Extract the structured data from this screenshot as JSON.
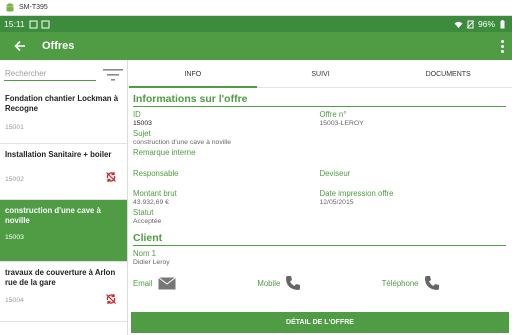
{
  "window": {
    "title": "SM-T395"
  },
  "statusbar": {
    "time": "15:11",
    "battery": "96%"
  },
  "appbar": {
    "title": "Offres"
  },
  "search": {
    "placeholder": "Rechercher"
  },
  "offers": [
    {
      "name": "Fondation chantier Lockman à Recogne",
      "number": "15001",
      "sync_icon": false,
      "selected": false
    },
    {
      "name": "Installation Sanitaire + boiler",
      "number": "15002",
      "sync_icon": true,
      "selected": false
    },
    {
      "name": "construction d'une cave à noville",
      "number": "15003",
      "sync_icon": false,
      "selected": true
    },
    {
      "name": "travaux de couverture à Arlon rue de la gare",
      "number": "15004",
      "sync_icon": true,
      "selected": false
    }
  ],
  "tabs": [
    {
      "label": "INFO",
      "active": true
    },
    {
      "label": "SUIVI",
      "active": false
    },
    {
      "label": "DOCUMENTS",
      "active": false
    }
  ],
  "offer_info": {
    "heading": "Informations sur l'offre",
    "id_label": "ID",
    "id_value": "15003",
    "offer_no_label": "Offre n°",
    "offer_no_value": "15003-LEROY",
    "subject_label": "Sujet",
    "subject_value": "construction d'une cave à noville",
    "internal_note_label": "Remarque interne",
    "manager_label": "Responsable",
    "currency_label": "Deviseur",
    "gross_label": "Montant brut",
    "gross_value": "43.932,69 €",
    "print_date_label": "Date impression offre",
    "print_date_value": "12/05/2015",
    "status_label": "Statut",
    "status_value": "Acceptée"
  },
  "client": {
    "heading": "Client",
    "name_label": "Nom 1",
    "name_value": "Didier Leroy",
    "email_label": "Email",
    "mobile_label": "Mobile",
    "phone_label": "Téléphone"
  },
  "detail_button": {
    "label": "DÉTAIL DE L'OFFRE"
  },
  "colors": {
    "primary": "#4f9c44",
    "status_bar": "#3d8b3d",
    "sync_icon": "#c62828"
  },
  "icons": [
    "android-icon",
    "back-arrow-icon",
    "more-vert-icon",
    "filter-icon",
    "sync-off-icon",
    "email-icon",
    "phone-icon"
  ]
}
